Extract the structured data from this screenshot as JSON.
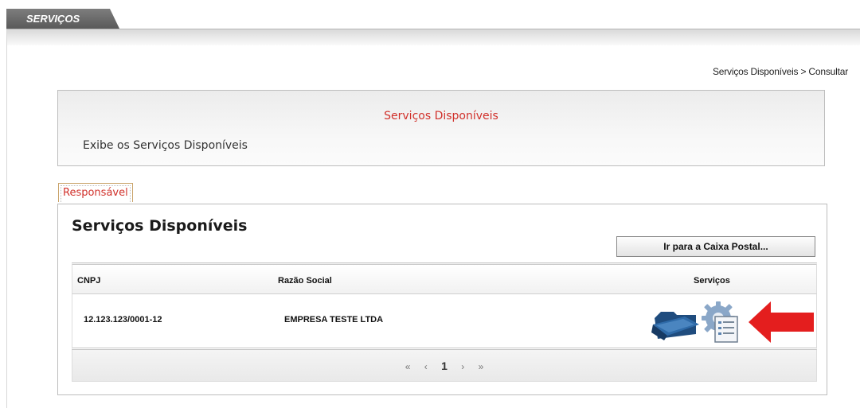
{
  "top_tab": {
    "label": "SERVIÇOS"
  },
  "breadcrumb": "Serviços Disponíveis > Consultar",
  "header": {
    "title": "Serviços Disponíveis",
    "description": "Exibe os Serviços Disponíveis"
  },
  "tab": {
    "label": "Responsável"
  },
  "panel": {
    "title": "Serviços Disponíveis",
    "postal_button": "Ir para a Caixa Postal..."
  },
  "table": {
    "columns": [
      "CNPJ",
      "Razão Social",
      "Serviços"
    ],
    "rows": [
      {
        "cnpj": "12.123.123/0001-12",
        "razao_social": "EMPRESA TESTE LTDA",
        "icons": [
          "folder-icon",
          "services-gear-icon",
          "red-arrow-icon"
        ]
      }
    ]
  },
  "pager": {
    "first": "«",
    "prev": "‹",
    "current": "1",
    "next": "›",
    "last": "»"
  },
  "colors": {
    "accent_red": "#d1312b",
    "tab_gray": "#666666",
    "arrow_red": "#e41e1e"
  }
}
